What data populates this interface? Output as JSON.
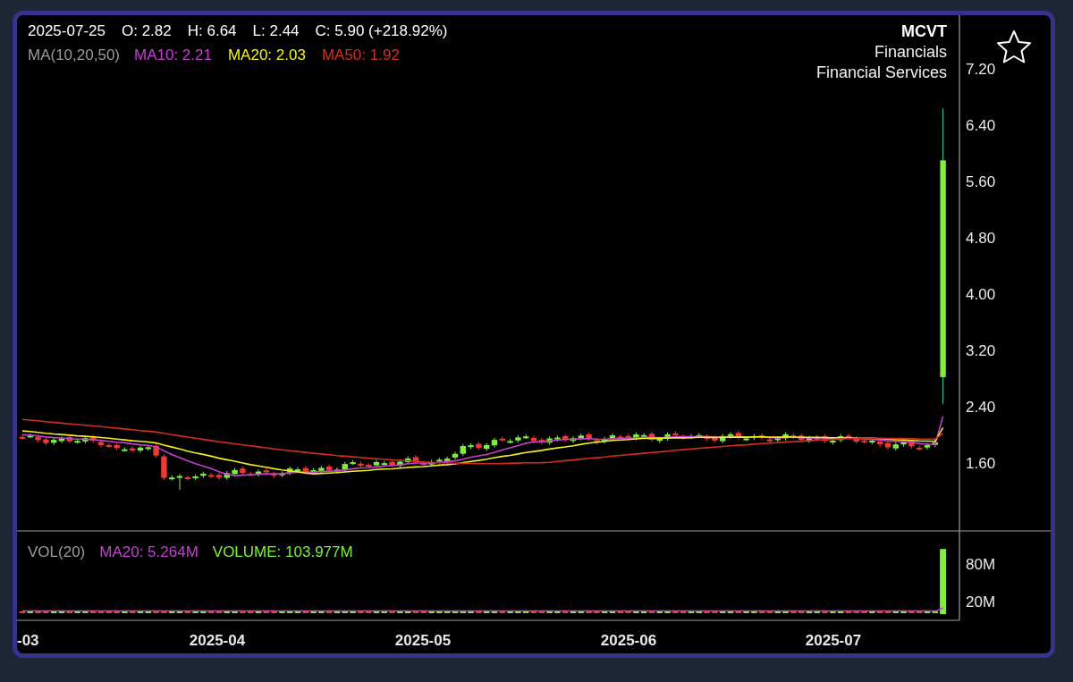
{
  "ohlc": [
    "2025-07-25",
    "O: 2.82",
    "H: 6.64",
    "L: 2.44",
    "C: 5.90 (+218.92%)"
  ],
  "ma_legend": {
    "label": "MA(10,20,50)",
    "items": [
      {
        "text": "MA10: 2.21",
        "color": "#c63ed2"
      },
      {
        "text": "MA20: 2.03",
        "color": "#f2f21c"
      },
      {
        "text": "MA50: 1.92",
        "color": "#d22f1f"
      }
    ]
  },
  "symbol": {
    "ticker": "MCVT",
    "sector": "Financials",
    "industry": "Financial Services"
  },
  "favorite": {
    "starred": false
  },
  "price_axis": {
    "ticks": [
      "7.20",
      "6.40",
      "5.60",
      "4.80",
      "4.00",
      "3.20",
      "2.40",
      "1.60"
    ]
  },
  "volume": {
    "label": "VOL(20)",
    "ma": {
      "text": "MA20: 5.264M",
      "color": "#c63ed2"
    },
    "volume": {
      "text": "VOLUME: 103.977M",
      "color": "#7cf03a"
    },
    "ticks": [
      "80M",
      "20M"
    ]
  },
  "date_axis": [
    "-03",
    "2025-04",
    "2025-05",
    "2025-06",
    "2025-07"
  ]
}
